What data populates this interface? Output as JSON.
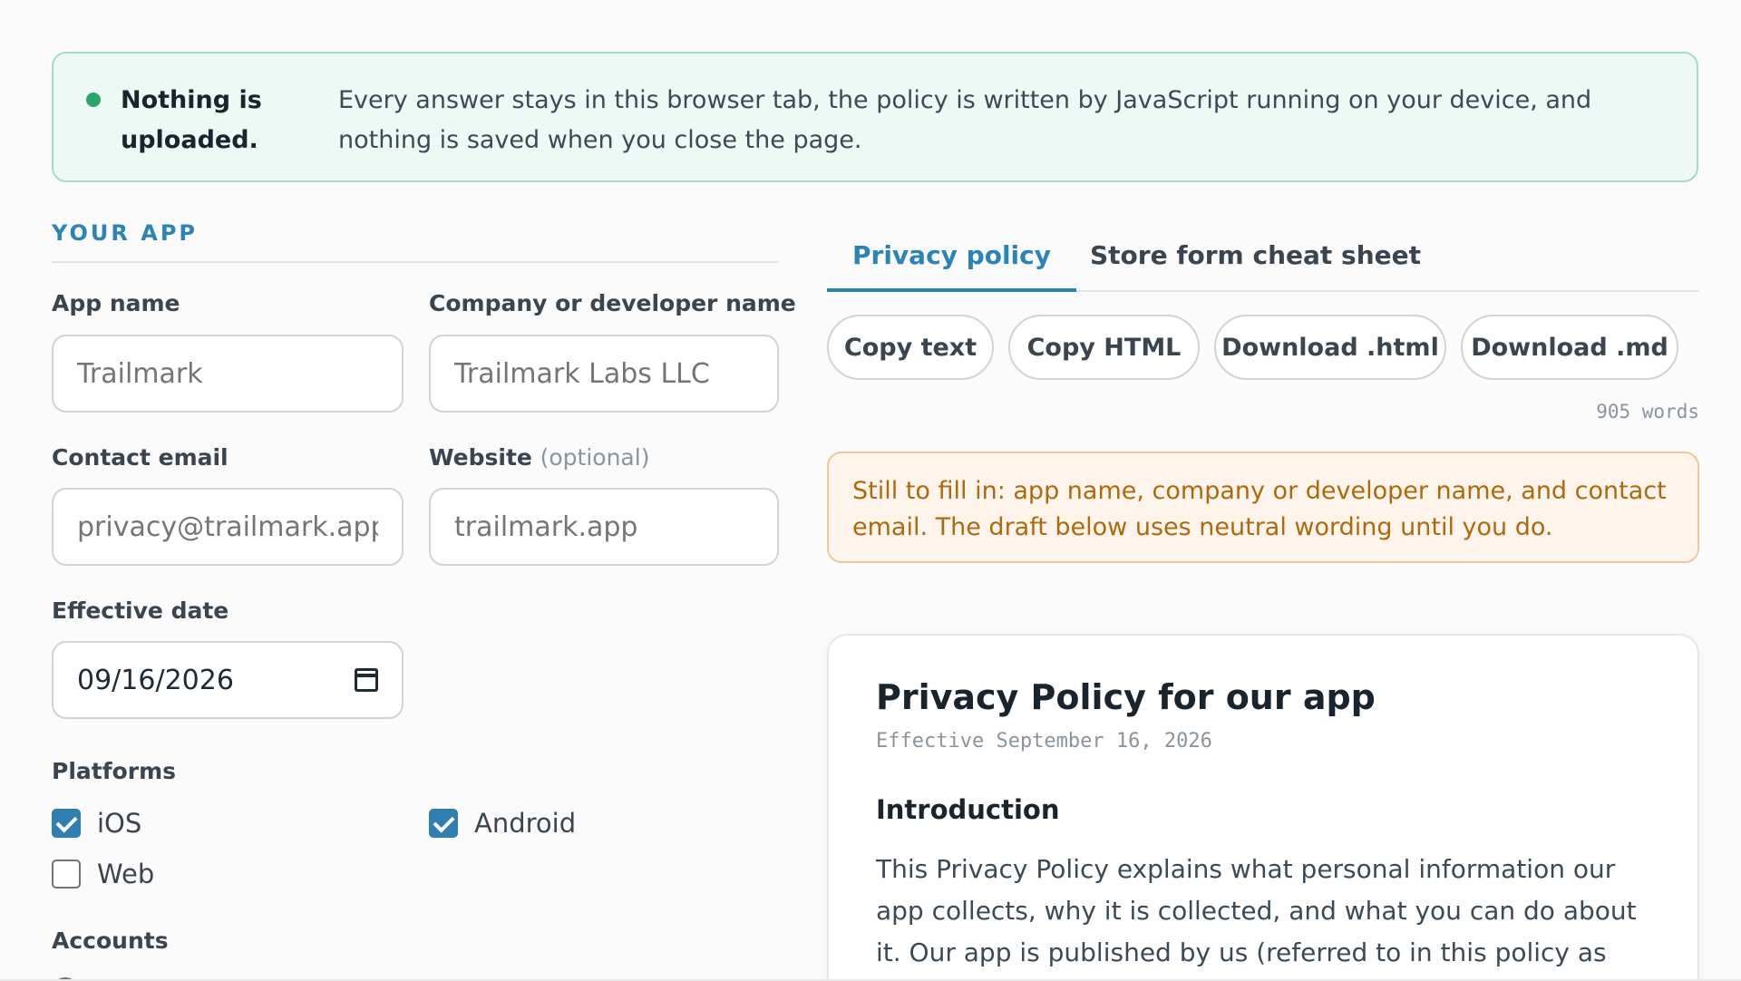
{
  "banner": {
    "strong": "Nothing is uploaded.",
    "text": "Every answer stays in this browser tab, the policy is written by JavaScript running on your device, and nothing is saved when you close the page."
  },
  "form": {
    "section_title": "YOUR APP",
    "app_name": {
      "label": "App name",
      "placeholder": "Trailmark"
    },
    "company": {
      "label": "Company or developer name",
      "placeholder": "Trailmark Labs LLC"
    },
    "email": {
      "label": "Contact email",
      "placeholder": "privacy@trailmark.app"
    },
    "website": {
      "label": "Website",
      "optional": "(optional)",
      "placeholder": "trailmark.app"
    },
    "effective_date": {
      "label": "Effective date",
      "value": "09/16/2026"
    },
    "platforms": {
      "label": "Platforms",
      "ios": {
        "label": "iOS",
        "checked": true
      },
      "android": {
        "label": "Android",
        "checked": true
      },
      "web": {
        "label": "Web",
        "checked": false
      }
    },
    "accounts_label": "Accounts"
  },
  "tabs": {
    "policy": "Privacy policy",
    "cheatsheet": "Store form cheat sheet"
  },
  "actions": {
    "copy_text": "Copy text",
    "copy_html": "Copy HTML",
    "download_html": "Download .html",
    "download_md": "Download .md"
  },
  "word_count": "905 words",
  "warning": "Still to fill in: app name, company or developer name, and contact email. The draft below uses neutral wording until you do.",
  "document": {
    "title": "Privacy Policy for our app",
    "effective": "Effective September 16, 2026",
    "intro_heading": "Introduction",
    "intro_text": "This Privacy Policy explains what personal information our app collects, why it is collected, and what you can do about it. Our app is published by us (referred to in this policy as"
  },
  "colors": {
    "accent": "#2b84b8",
    "success": "#27a86a",
    "warning": "#b0690a"
  }
}
